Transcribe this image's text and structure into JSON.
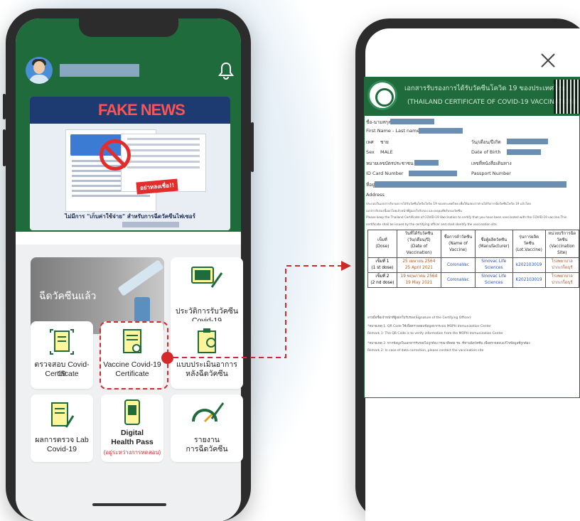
{
  "app": {
    "banner": {
      "headline": "FAKE NEWS",
      "stamp": "อย่าหลงเชื่อ!!",
      "caption": "ไม่มีการ \"เก็บค่าใช้จ่าย\" สำหรับการฉีดวัคซีนไฟเซอร์"
    },
    "featured_tile": {
      "label": "ฉีดวัคซีนแล้ว"
    },
    "tiles": [
      {
        "label": "ประวัติการรับวัคซีน",
        "sub": "Covid-19"
      },
      {
        "label": "ตรวจสอบ Covid-19",
        "sub": "Certificate"
      },
      {
        "label": "Vaccine Covid-19",
        "sub": "Certificate"
      },
      {
        "label": "แบบประเมินอาการ",
        "sub": "หลังฉีดวัคซีน"
      },
      {
        "label": "ผลการตรวจ Lab",
        "sub": "Covid-19"
      },
      {
        "label": "Digital",
        "sub": "Health Pass",
        "note": "(อยู่ระหว่างการทดสอบ)"
      },
      {
        "label": "รายงาน",
        "sub": "การฉีดวัคซีน"
      }
    ]
  },
  "certificate": {
    "title_th": "เอกสารรับรองการได้รับวัคซีนโควิด 19 ของประเทศไทย",
    "title_en": "(THAILAND CERTIFICATE OF COVID-19 VACCINATION)",
    "name_th": "ชื่อ-นามสกุล",
    "name_en": "First Name - Last name",
    "sex_th": "เพศ",
    "sex_th_val": "ชาย",
    "dob_th": "วัน/เดือน/ปีเกิด",
    "sex_en": "Sex",
    "sex_en_val": "MALE",
    "dob_en": "Date of Birth",
    "id_th": "หมายเลขบัตรประชาชน",
    "passport_th": "เลขที่หนังสือเดินทาง",
    "id_en": "ID Card Number",
    "passport_en": "Passport Number",
    "address_th": "ที่อยู่",
    "address_en": "Address",
    "para_th1": "ประกอบในเอกสารรับรองการได้รับวัคซีนโควิดโควิด 19 ของประเทศไทย เพื่อให้แสดงว่าท่านได้รับการฉีดวัคซีนโควิด 19 แล้วโดย",
    "para_th2": "เอกสารรับรองนี้ออกโดยเจ้าหน้าที่ผู้ออกใบรับรอง และลงมุมเทียรับรองวัคซีน",
    "para_en1": "Please keep the Thailand Certificate of COVID-19 Vaccination to certify that you have been vaccinated with the COVID-19 vaccine.This",
    "para_en2": "certificate shall be issued by the certifying officer and shall identify the vaccination site.",
    "headers": {
      "dose": [
        "เข็มที่",
        "(Dose)"
      ],
      "date": [
        "วันที่ได้รับวัคซีน",
        "(วัน/เดือน/ปี)",
        "(Date of",
        "Vaccination)"
      ],
      "name": [
        "ชื่อการค้าวัคซีน",
        "(Name of",
        "Vaccine)"
      ],
      "mfr": [
        "ชื่อผู้ผลิตวัคซีน",
        "(Manufacturer)"
      ],
      "lot": [
        "รุ่นการผลิต",
        "วัคซีน",
        "(Lot.Vaccine)"
      ],
      "site": [
        "หน่วยบริการฉีด",
        "วัคซีน",
        "(Vaccination",
        "Site)"
      ]
    },
    "doses": [
      {
        "dose_th": "เข็มที่ 1",
        "dose_en": "(1 st dose)",
        "date_th": "25 เมษายน 2564",
        "date_en": "25 April 2021",
        "vaccine": "CoronaVac",
        "mfr1": "Sinovac Life",
        "mfr2": "Sciences",
        "lot": "k202103019",
        "site1": "โรงพยาบาล",
        "site2": "ปากเกร็ดบุรี"
      },
      {
        "dose_th": "เข็มที่ 2",
        "dose_en": "(2 nd dose)",
        "date_th": "19 พฤษภาคม 2564",
        "date_en": "19 May 2021",
        "vaccine": "CoronaVac",
        "mfr1": "Sinovac Life",
        "mfr2": "Sciences",
        "lot": "K202103019",
        "site1": "โรงพยาบาล",
        "site2": "ปากเกร็ดบุรี"
      }
    ],
    "footer": [
      "ลายมือชื่อเจ้าหน้าที่ผู้ออกใบรับรอง(Signature of the Certifying Officer)",
      "*หมายเหตุ 1: QR Code ใช้เพื่อตรวจสอบข้อมูลจากระบบ MOPH Immunization Center",
      "Remark 1: The QR Code is to verify information from the MOPH Immunization Center",
      "*หมายเหตุ 2: หากข้อมูลในเอกสารรับรองไม่ถูกต้อง กรุณาติดต่อ รพ. ที่ท่านฉีดวัคซีน เพื่อตรวจสอบแก้ไขข้อมูลที่ถูกต้อง",
      "Remark 2: In case of data correction, please contact the vaccination site"
    ]
  },
  "colors": {
    "green": "#1f6b3c",
    "red": "#d42a2a"
  }
}
